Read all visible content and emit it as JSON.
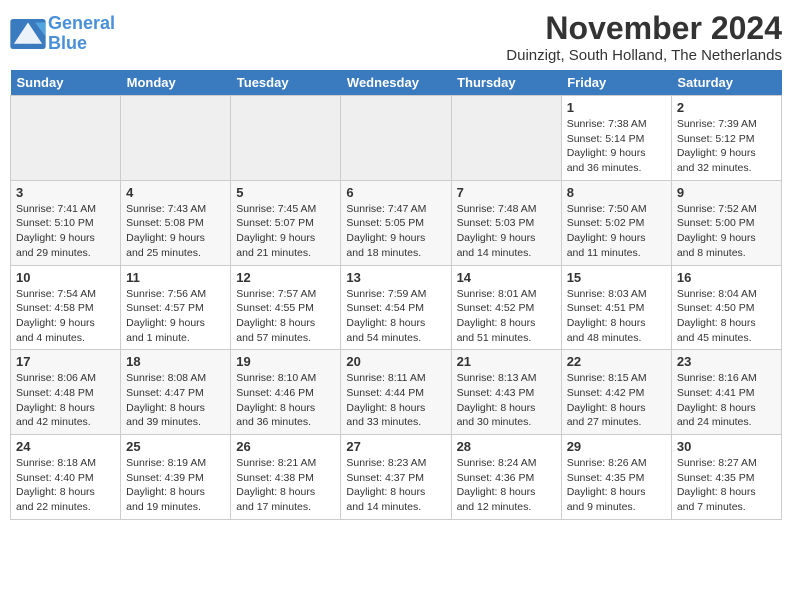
{
  "header": {
    "logo_line1": "General",
    "logo_line2": "Blue",
    "month_title": "November 2024",
    "location": "Duinzigt, South Holland, The Netherlands"
  },
  "days_of_week": [
    "Sunday",
    "Monday",
    "Tuesday",
    "Wednesday",
    "Thursday",
    "Friday",
    "Saturday"
  ],
  "weeks": [
    {
      "days": [
        {
          "num": "",
          "empty": true
        },
        {
          "num": "",
          "empty": true
        },
        {
          "num": "",
          "empty": true
        },
        {
          "num": "",
          "empty": true
        },
        {
          "num": "",
          "empty": true
        },
        {
          "num": "1",
          "info": "Sunrise: 7:38 AM\nSunset: 5:14 PM\nDaylight: 9 hours\nand 36 minutes."
        },
        {
          "num": "2",
          "info": "Sunrise: 7:39 AM\nSunset: 5:12 PM\nDaylight: 9 hours\nand 32 minutes."
        }
      ]
    },
    {
      "days": [
        {
          "num": "3",
          "info": "Sunrise: 7:41 AM\nSunset: 5:10 PM\nDaylight: 9 hours\nand 29 minutes."
        },
        {
          "num": "4",
          "info": "Sunrise: 7:43 AM\nSunset: 5:08 PM\nDaylight: 9 hours\nand 25 minutes."
        },
        {
          "num": "5",
          "info": "Sunrise: 7:45 AM\nSunset: 5:07 PM\nDaylight: 9 hours\nand 21 minutes."
        },
        {
          "num": "6",
          "info": "Sunrise: 7:47 AM\nSunset: 5:05 PM\nDaylight: 9 hours\nand 18 minutes."
        },
        {
          "num": "7",
          "info": "Sunrise: 7:48 AM\nSunset: 5:03 PM\nDaylight: 9 hours\nand 14 minutes."
        },
        {
          "num": "8",
          "info": "Sunrise: 7:50 AM\nSunset: 5:02 PM\nDaylight: 9 hours\nand 11 minutes."
        },
        {
          "num": "9",
          "info": "Sunrise: 7:52 AM\nSunset: 5:00 PM\nDaylight: 9 hours\nand 8 minutes."
        }
      ]
    },
    {
      "days": [
        {
          "num": "10",
          "info": "Sunrise: 7:54 AM\nSunset: 4:58 PM\nDaylight: 9 hours\nand 4 minutes."
        },
        {
          "num": "11",
          "info": "Sunrise: 7:56 AM\nSunset: 4:57 PM\nDaylight: 9 hours\nand 1 minute."
        },
        {
          "num": "12",
          "info": "Sunrise: 7:57 AM\nSunset: 4:55 PM\nDaylight: 8 hours\nand 57 minutes."
        },
        {
          "num": "13",
          "info": "Sunrise: 7:59 AM\nSunset: 4:54 PM\nDaylight: 8 hours\nand 54 minutes."
        },
        {
          "num": "14",
          "info": "Sunrise: 8:01 AM\nSunset: 4:52 PM\nDaylight: 8 hours\nand 51 minutes."
        },
        {
          "num": "15",
          "info": "Sunrise: 8:03 AM\nSunset: 4:51 PM\nDaylight: 8 hours\nand 48 minutes."
        },
        {
          "num": "16",
          "info": "Sunrise: 8:04 AM\nSunset: 4:50 PM\nDaylight: 8 hours\nand 45 minutes."
        }
      ]
    },
    {
      "days": [
        {
          "num": "17",
          "info": "Sunrise: 8:06 AM\nSunset: 4:48 PM\nDaylight: 8 hours\nand 42 minutes."
        },
        {
          "num": "18",
          "info": "Sunrise: 8:08 AM\nSunset: 4:47 PM\nDaylight: 8 hours\nand 39 minutes."
        },
        {
          "num": "19",
          "info": "Sunrise: 8:10 AM\nSunset: 4:46 PM\nDaylight: 8 hours\nand 36 minutes."
        },
        {
          "num": "20",
          "info": "Sunrise: 8:11 AM\nSunset: 4:44 PM\nDaylight: 8 hours\nand 33 minutes."
        },
        {
          "num": "21",
          "info": "Sunrise: 8:13 AM\nSunset: 4:43 PM\nDaylight: 8 hours\nand 30 minutes."
        },
        {
          "num": "22",
          "info": "Sunrise: 8:15 AM\nSunset: 4:42 PM\nDaylight: 8 hours\nand 27 minutes."
        },
        {
          "num": "23",
          "info": "Sunrise: 8:16 AM\nSunset: 4:41 PM\nDaylight: 8 hours\nand 24 minutes."
        }
      ]
    },
    {
      "days": [
        {
          "num": "24",
          "info": "Sunrise: 8:18 AM\nSunset: 4:40 PM\nDaylight: 8 hours\nand 22 minutes."
        },
        {
          "num": "25",
          "info": "Sunrise: 8:19 AM\nSunset: 4:39 PM\nDaylight: 8 hours\nand 19 minutes."
        },
        {
          "num": "26",
          "info": "Sunrise: 8:21 AM\nSunset: 4:38 PM\nDaylight: 8 hours\nand 17 minutes."
        },
        {
          "num": "27",
          "info": "Sunrise: 8:23 AM\nSunset: 4:37 PM\nDaylight: 8 hours\nand 14 minutes."
        },
        {
          "num": "28",
          "info": "Sunrise: 8:24 AM\nSunset: 4:36 PM\nDaylight: 8 hours\nand 12 minutes."
        },
        {
          "num": "29",
          "info": "Sunrise: 8:26 AM\nSunset: 4:35 PM\nDaylight: 8 hours\nand 9 minutes."
        },
        {
          "num": "30",
          "info": "Sunrise: 8:27 AM\nSunset: 4:35 PM\nDaylight: 8 hours\nand 7 minutes."
        }
      ]
    }
  ]
}
